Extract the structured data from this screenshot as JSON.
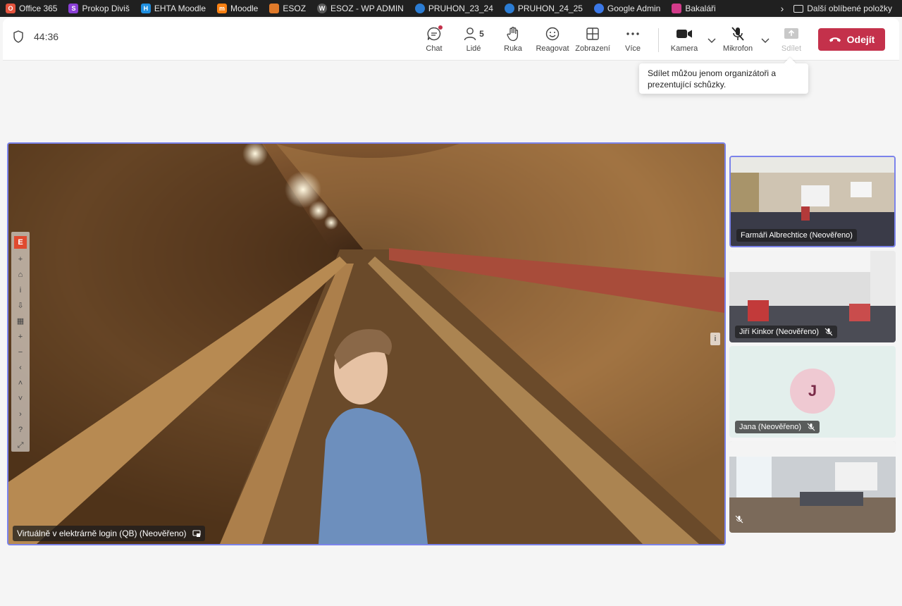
{
  "bookmarks": [
    {
      "label": "Office 365",
      "icon": "office-icon",
      "color": "#e5533d"
    },
    {
      "label": "Prokop Diviš",
      "icon": "prokop-icon",
      "color": "#8b3fd6"
    },
    {
      "label": "EHTA Moodle",
      "icon": "ehta-icon",
      "color": "#1f8fe0"
    },
    {
      "label": "Moodle",
      "icon": "moodle-icon",
      "color": "#f98012"
    },
    {
      "label": "ESOZ",
      "icon": "esoz-icon",
      "color": "#e07a2a"
    },
    {
      "label": "ESOZ - WP ADMIN",
      "icon": "wordpress-icon",
      "color": "#3a3a3a"
    },
    {
      "label": "PRUHON_23_24",
      "icon": "onedrive-icon",
      "color": "#2b7cd3"
    },
    {
      "label": "PRUHON_24_25",
      "icon": "onedrive-icon",
      "color": "#2b7cd3"
    },
    {
      "label": "Google Admin",
      "icon": "google-admin-icon",
      "color": "#3b78e7"
    },
    {
      "label": "Bakaláři",
      "icon": "bakalari-icon",
      "color": "#d23b8a"
    }
  ],
  "bookmarks_other": "Další oblíbené položky",
  "call": {
    "timer": "44:36",
    "controls": {
      "chat": "Chat",
      "people": "Lidé",
      "people_count": "5",
      "raise_hand": "Ruka",
      "react": "Reagovat",
      "view": "Zobrazení",
      "more": "Více",
      "camera": "Kamera",
      "mic": "Mikrofon",
      "share": "Sdílet",
      "leave": "Odejít"
    },
    "share_tooltip": "Sdílet můžou jenom organizátoři a prezentující schůzky."
  },
  "main_video": {
    "name": "Virtuálně v elektrárně login (QB) (Neověřeno)"
  },
  "tiles": [
    {
      "name": "Farmáři Albrechtice (Neověřeno)",
      "muted": false,
      "active": true
    },
    {
      "name": "Jiří Kinkor (Neověřeno)",
      "muted": true,
      "active": false
    },
    {
      "name": "Jana (Neověřeno)",
      "muted": true,
      "active": false,
      "avatar": "J"
    },
    {
      "name": "",
      "muted": true,
      "active": false
    }
  ],
  "colors": {
    "accent": "#7b83eb",
    "leave": "#c4314b"
  }
}
